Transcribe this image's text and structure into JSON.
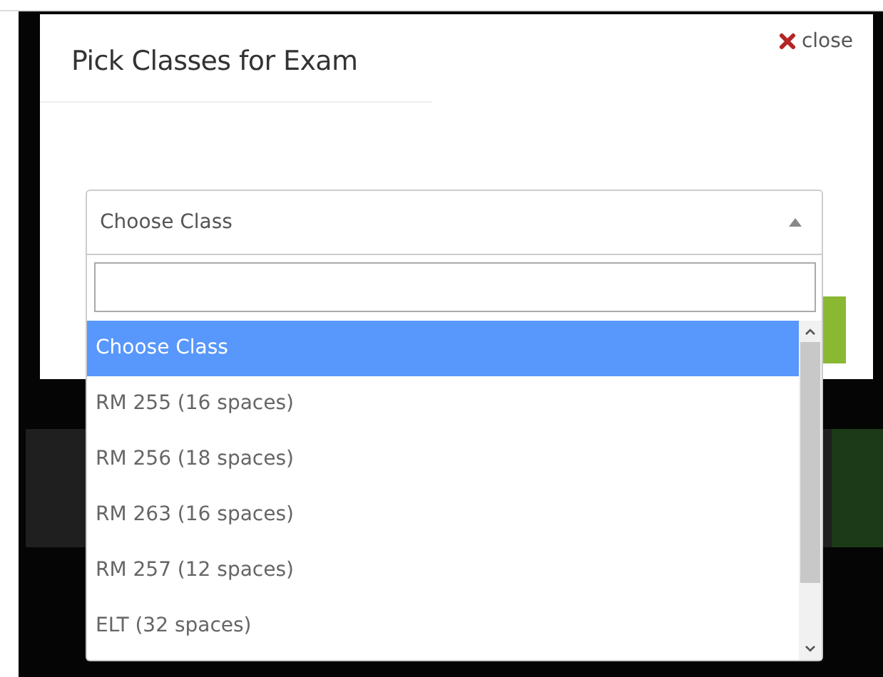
{
  "dialog": {
    "title": "Pick Classes for Exam",
    "close_label": "close"
  },
  "select": {
    "value": "Choose Class",
    "expanded": true,
    "options": [
      {
        "label": "Choose Class",
        "selected": true
      },
      {
        "label": "RM 255 (16 spaces)",
        "selected": false
      },
      {
        "label": "RM 256 (18 spaces)",
        "selected": false
      },
      {
        "label": "RM 263 (16 spaces)",
        "selected": false
      },
      {
        "label": "RM 257 (12 spaces)",
        "selected": false
      },
      {
        "label": "ELT (32 spaces)",
        "selected": false
      }
    ]
  }
}
